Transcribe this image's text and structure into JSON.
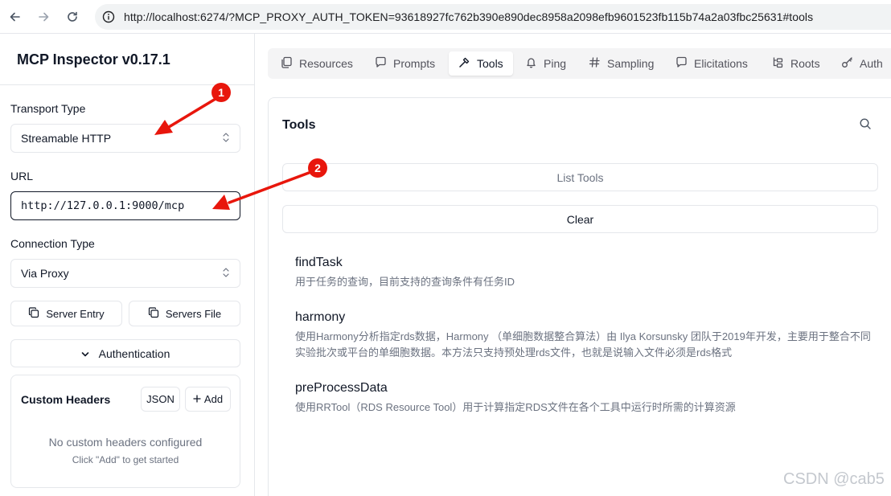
{
  "browser": {
    "url": "http://localhost:6274/?MCP_PROXY_AUTH_TOKEN=93618927fc762b390e890dec8958a2098efb9601523fb115b74a2a03fbc25631#tools"
  },
  "sidebar": {
    "app_title": "MCP Inspector v0.17.1",
    "transport_label": "Transport Type",
    "transport_value": "Streamable HTTP",
    "url_label": "URL",
    "url_value": "http://127.0.0.1:9000/mcp",
    "connection_label": "Connection Type",
    "connection_value": "Via Proxy",
    "server_entry_label": "Server Entry",
    "servers_file_label": "Servers File",
    "authentication_label": "Authentication",
    "custom_headers": {
      "title": "Custom Headers",
      "json_label": "JSON",
      "add_label": "Add",
      "empty_title": "No custom headers configured",
      "empty_subtitle": "Click \"Add\" to get started"
    }
  },
  "tabs": [
    {
      "label": "Resources",
      "icon": "resources-icon"
    },
    {
      "label": "Prompts",
      "icon": "chat-icon"
    },
    {
      "label": "Tools",
      "icon": "hammer-icon",
      "active": true
    },
    {
      "label": "Ping",
      "icon": "bell-icon"
    },
    {
      "label": "Sampling",
      "icon": "hash-icon"
    },
    {
      "label": "Elicitations",
      "icon": "message-icon"
    },
    {
      "label": "Roots",
      "icon": "folder-tree-icon"
    },
    {
      "label": "Auth",
      "icon": "key-icon"
    }
  ],
  "tools_panel": {
    "title": "Tools",
    "list_button": "List Tools",
    "clear_button": "Clear",
    "items": [
      {
        "name": "findTask",
        "description": "用于任务的查询，目前支持的查询条件有任务ID"
      },
      {
        "name": "harmony",
        "description": "使用Harmony分析指定rds数据，Harmony （单细胞数据整合算法）由 Ilya Korsunsky 团队于2019年开发，主要用于整合不同实验批次或平台的单细胞数据。本方法只支持预处理rds文件，也就是说输入文件必须是rds格式"
      },
      {
        "name": "preProcessData",
        "description": "使用RRTool（RDS Resource Tool）用于计算指定RDS文件在各个工具中运行时所需的计算资源"
      }
    ]
  },
  "annotations": {
    "marker_1": "1",
    "marker_2": "2",
    "watermark": "CSDN @cab5",
    "accent_color": "#e8160c"
  }
}
